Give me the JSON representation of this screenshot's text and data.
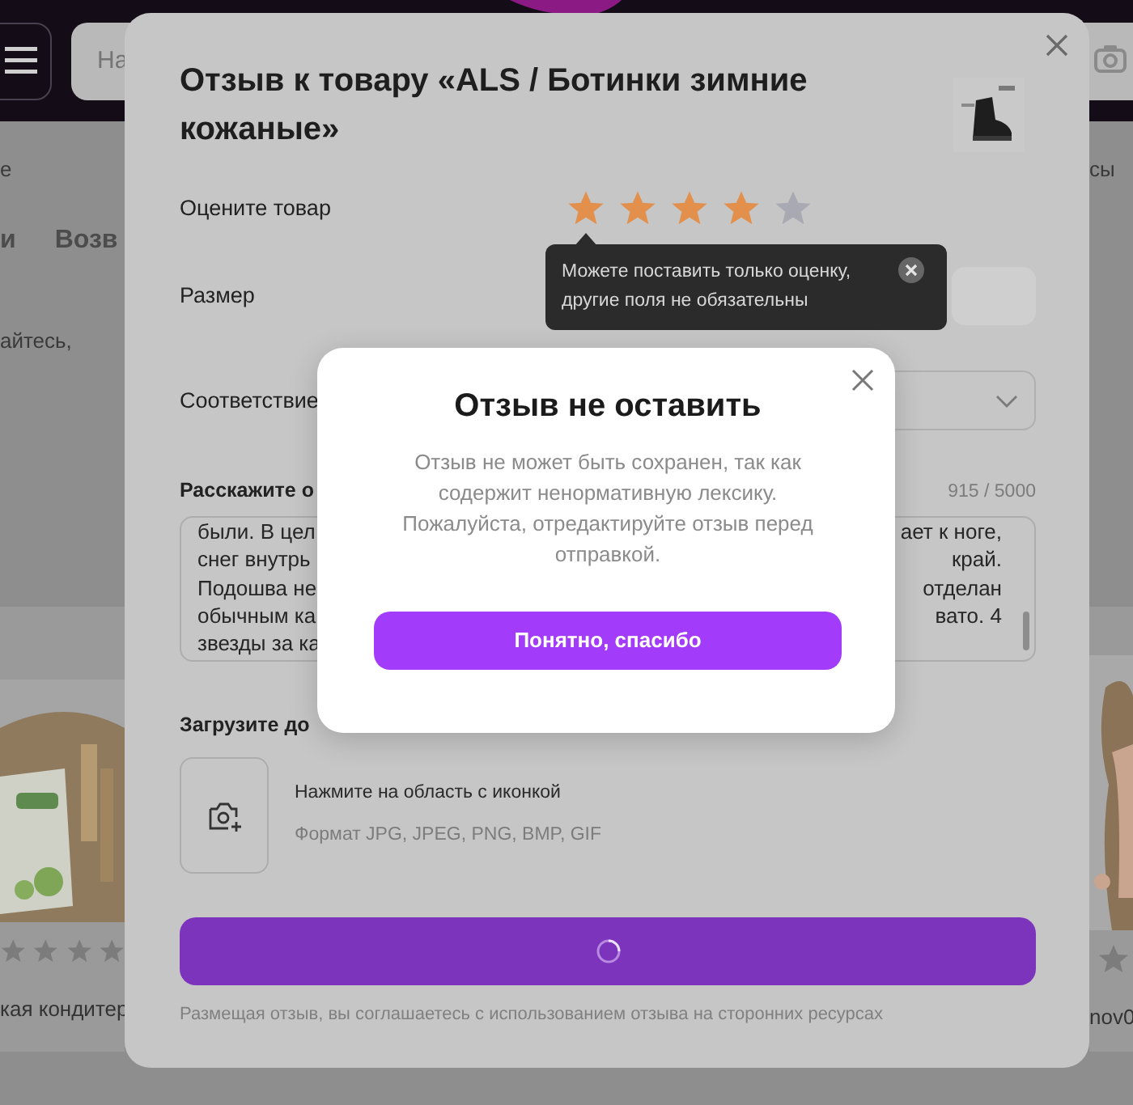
{
  "header": {
    "search_placeholder": "На"
  },
  "background": {
    "left_lines": [
      {
        "kind": "plain",
        "parts": [
          "е"
        ]
      },
      {
        "kind": "tab",
        "parts": [
          "и",
          "Возв"
        ]
      },
      {
        "kind": "plain",
        "parts": [
          "айтесь,"
        ]
      }
    ],
    "right_lines": [
      {
        "kind": "plain",
        "parts": [
          "сы"
        ]
      }
    ],
    "cards": [
      {
        "caption": "кая кондитер"
      },
      {
        "caption": "nov0"
      }
    ]
  },
  "review_modal": {
    "title": "Отзыв к товару «ALS / Ботинки зимние кожаные»",
    "rating": {
      "label": "Оцените товар",
      "stars": 4
    },
    "size": {
      "label": "Размер"
    },
    "fit": {
      "label": "Соответствие"
    },
    "review": {
      "label": "Расскажите о",
      "counter": "915 / 5000",
      "lines": [
        {
          "left": "были. В цел",
          "right": "ает к ноге,"
        },
        {
          "left": "снег внутрь",
          "right": "край."
        },
        {
          "left": "Подошва не",
          "right": "отделан"
        },
        {
          "left": "обычным ка",
          "right": "вато. 4"
        },
        {
          "left": "звезды за ка"
        }
      ]
    },
    "upload": {
      "label": "Загрузите до",
      "hint": "Нажмите на область с иконкой",
      "formats": "Формат JPG, JPEG, PNG, BMP, GIF"
    },
    "submit": {
      "loading": true
    },
    "disclaimer": "Размещая отзыв, вы соглашаетесь с использованием отзыва на сторонних ресурсах"
  },
  "tooltip": {
    "text": "Можете поставить только оценку, другие поля не обязательны"
  },
  "error_dialog": {
    "title": "Отзыв не оставить",
    "message": "Отзыв не может быть сохранен, так как содержит ненормативную лексику. Пожалуйста, отредактируйте отзыв перед отправкой.",
    "button": "Понятно, спасибо"
  }
}
